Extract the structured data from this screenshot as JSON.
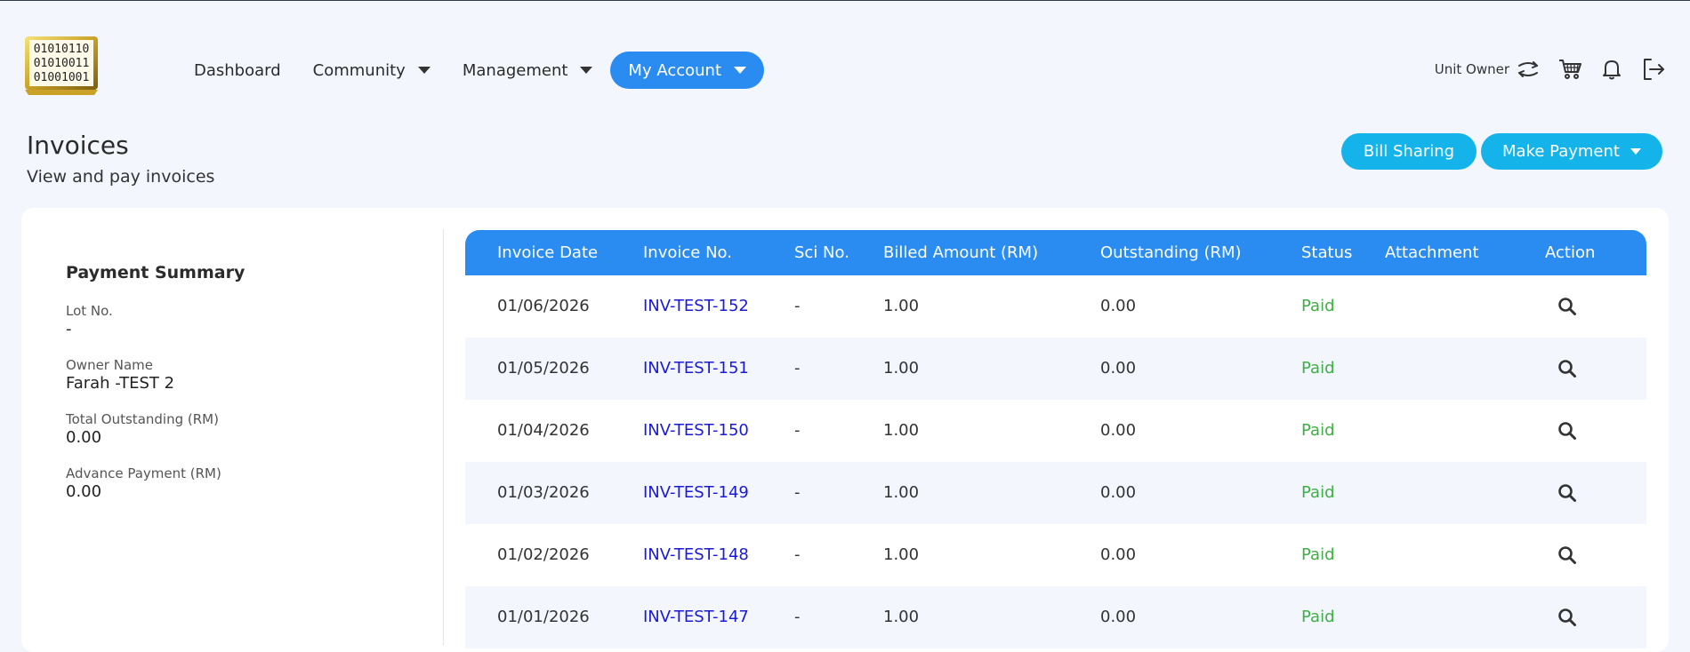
{
  "header": {
    "logo_lines": [
      "01010110",
      "01010011",
      "01001001"
    ],
    "nav": [
      {
        "label": "Dashboard",
        "dropdown": false
      },
      {
        "label": "Community",
        "dropdown": true
      },
      {
        "label": "Management",
        "dropdown": true
      },
      {
        "label": "My Account",
        "dropdown": true,
        "active": true
      }
    ],
    "role_label": "Unit Owner",
    "icons": [
      "switch-role-icon",
      "cart-icon",
      "bell-icon",
      "logout-icon"
    ]
  },
  "page": {
    "title": "Invoices",
    "subtitle": "View and pay invoices",
    "bill_sharing_label": "Bill Sharing",
    "make_payment_label": "Make Payment"
  },
  "summary": {
    "title": "Payment Summary",
    "lot_label": "Lot No.",
    "lot_value": "-",
    "owner_label": "Owner Name",
    "owner_value": "Farah -TEST 2",
    "outstanding_label": "Total Outstanding (RM)",
    "outstanding_value": "0.00",
    "advance_label": "Advance Payment (RM)",
    "advance_value": "0.00"
  },
  "table": {
    "columns": [
      "Invoice Date",
      "Invoice No.",
      "Sci No.",
      "Billed Amount (RM)",
      "Outstanding (RM)",
      "Status",
      "Attachment",
      "Action"
    ],
    "rows": [
      {
        "date": "01/06/2026",
        "invoice": "INV-TEST-152",
        "sci": "-",
        "billed": "1.00",
        "outstanding": "0.00",
        "status": "Paid",
        "attachment": ""
      },
      {
        "date": "01/05/2026",
        "invoice": "INV-TEST-151",
        "sci": "-",
        "billed": "1.00",
        "outstanding": "0.00",
        "status": "Paid",
        "attachment": ""
      },
      {
        "date": "01/04/2026",
        "invoice": "INV-TEST-150",
        "sci": "-",
        "billed": "1.00",
        "outstanding": "0.00",
        "status": "Paid",
        "attachment": ""
      },
      {
        "date": "01/03/2026",
        "invoice": "INV-TEST-149",
        "sci": "-",
        "billed": "1.00",
        "outstanding": "0.00",
        "status": "Paid",
        "attachment": ""
      },
      {
        "date": "01/02/2026",
        "invoice": "INV-TEST-148",
        "sci": "-",
        "billed": "1.00",
        "outstanding": "0.00",
        "status": "Paid",
        "attachment": ""
      },
      {
        "date": "01/01/2026",
        "invoice": "INV-TEST-147",
        "sci": "-",
        "billed": "1.00",
        "outstanding": "0.00",
        "status": "Paid",
        "attachment": ""
      }
    ]
  },
  "colors": {
    "primary_blue": "#2a8cf0",
    "cyan_button": "#14b4ea",
    "paid_green": "#3cb043",
    "link_blue": "#1a1ad6",
    "background": "#f3f6fd"
  }
}
